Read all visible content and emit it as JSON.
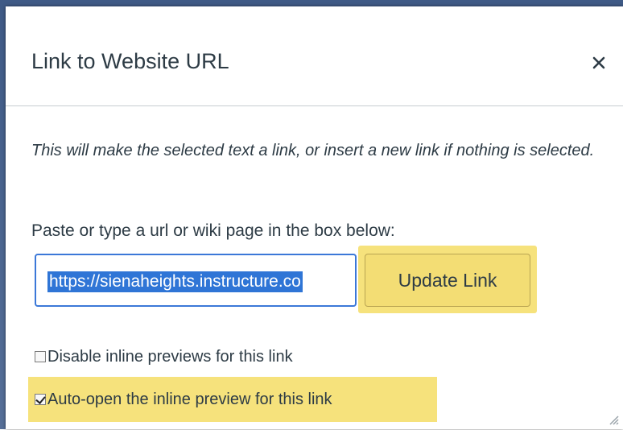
{
  "dialog": {
    "title": "Link to Website URL",
    "close_icon": "close-icon",
    "description": "This will make the selected text a link, or insert a new link if nothing is selected.",
    "prompt": "Paste or type a url or wiki page in the box below:",
    "url_value": "https://sienaheights.instructure.co",
    "update_button_label": "Update Link",
    "options": [
      {
        "label": "Disable inline previews for this link",
        "checked": false
      },
      {
        "label": "Auto-open the inline preview for this link",
        "checked": true
      }
    ],
    "highlight_color": "#f6e27c",
    "selection_color": "#2f75d6"
  }
}
